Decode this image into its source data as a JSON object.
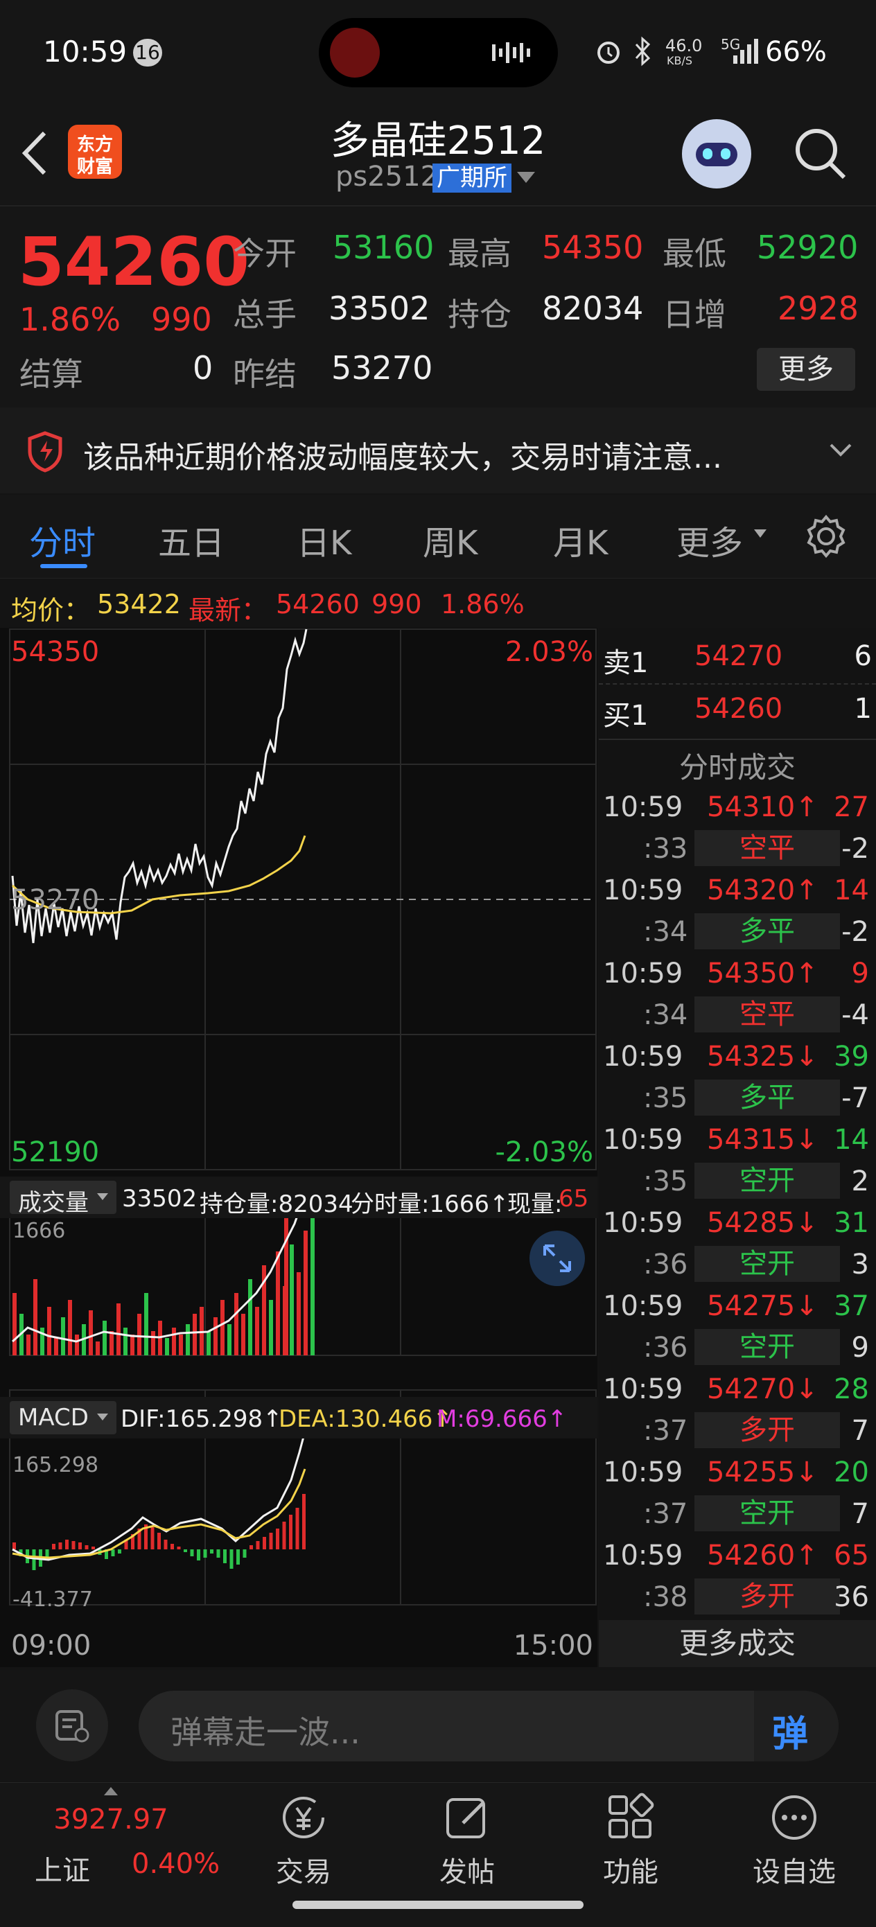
{
  "status": {
    "time": "10:59",
    "notif_count": "16",
    "net_speed": "46.0",
    "net_unit": "KB/S",
    "net_type": "5G",
    "battery": "66%"
  },
  "header": {
    "title": "多晶硅2512",
    "code": "ps2512",
    "exchange": "广期所",
    "app_logo_line1": "东方",
    "app_logo_line2": "财富"
  },
  "quote": {
    "last": "54260",
    "change_pct": "1.86%",
    "change": "990",
    "open_label": "今开",
    "open": "53160",
    "high_label": "最高",
    "high": "54350",
    "low_label": "最低",
    "low": "52920",
    "volume_label": "总手",
    "volume": "33502",
    "oi_label": "持仓",
    "oi": "82034",
    "daily_inc_label": "日增",
    "daily_inc": "2928",
    "settle_label": "结算",
    "settle": "0",
    "prev_settle_label": "昨结",
    "prev_settle": "53270",
    "more_button": "更多"
  },
  "notice": {
    "text": "该品种近期价格波动幅度较大，交易时请注意..."
  },
  "tabs": [
    {
      "label": "分时",
      "active": true
    },
    {
      "label": "五日"
    },
    {
      "label": "日K"
    },
    {
      "label": "周K"
    },
    {
      "label": "月K"
    },
    {
      "label": "更多"
    }
  ],
  "info_line": {
    "avg_label": "均价：",
    "avg": "53422",
    "latest_label": "最新：",
    "latest": "54260",
    "chg": "990",
    "pct": "1.86%"
  },
  "price_chart": {
    "y_top": "54350",
    "y_top_pct": "2.03%",
    "y_mid": "53270",
    "y_bottom": "52190",
    "y_bottom_pct": "-2.03%",
    "time_start": "09:00",
    "time_end": "15:00"
  },
  "volume_panel": {
    "selector": "成交量",
    "value": "33502",
    "oi": "持仓量:82034",
    "minute_vol": "分时量:1666↑",
    "current_label": "现量:",
    "current": "65",
    "scale": "1666"
  },
  "macd_panel": {
    "selector": "MACD",
    "dif": "DIF:165.298↑",
    "dea": "DEA:130.466↑",
    "m": "M:69.666↑",
    "scale_top": "165.298",
    "scale_bottom": "-41.377"
  },
  "order_book": [
    {
      "label": "卖1",
      "price": "54270",
      "qty": "6"
    },
    {
      "label": "买1",
      "price": "54260",
      "qty": "1"
    }
  ],
  "trades_title": "分时成交",
  "trades": [
    {
      "time": "10:59",
      "sec": ":33",
      "price": "54310↑",
      "dir": "up",
      "vol": "27",
      "type": "空平",
      "type_color": "red",
      "oi": "-2"
    },
    {
      "time": "10:59",
      "sec": ":34",
      "price": "54320↑",
      "dir": "up",
      "vol": "14",
      "type": "多平",
      "type_color": "green",
      "oi": "-2"
    },
    {
      "time": "10:59",
      "sec": ":34",
      "price": "54350↑",
      "dir": "up",
      "vol": "9",
      "type": "空平",
      "type_color": "red",
      "oi": "-4"
    },
    {
      "time": "10:59",
      "sec": ":35",
      "price": "54325↓",
      "dir": "down",
      "vol": "39",
      "type": "多平",
      "type_color": "green",
      "oi": "-7"
    },
    {
      "time": "10:59",
      "sec": ":35",
      "price": "54315↓",
      "dir": "down",
      "vol": "14",
      "type": "空开",
      "type_color": "green",
      "oi": "2"
    },
    {
      "time": "10:59",
      "sec": ":36",
      "price": "54285↓",
      "dir": "down",
      "vol": "31",
      "type": "空开",
      "type_color": "green",
      "oi": "3"
    },
    {
      "time": "10:59",
      "sec": ":36",
      "price": "54275↓",
      "dir": "down",
      "vol": "37",
      "type": "空开",
      "type_color": "green",
      "oi": "9"
    },
    {
      "time": "10:59",
      "sec": ":37",
      "price": "54270↓",
      "dir": "down",
      "vol": "28",
      "type": "多开",
      "type_color": "red",
      "oi": "7"
    },
    {
      "time": "10:59",
      "sec": ":37",
      "price": "54255↓",
      "dir": "down",
      "vol": "20",
      "type": "空开",
      "type_color": "green",
      "oi": "7"
    },
    {
      "time": "10:59",
      "sec": ":38",
      "price": "54260↑",
      "dir": "up",
      "vol": "65",
      "type": "多开",
      "type_color": "red",
      "oi": "36"
    }
  ],
  "more_trades": "更多成交",
  "danmu": {
    "placeholder": "弹幕走一波...",
    "send": "弹"
  },
  "bottom_nav": {
    "index_value": "3927.97",
    "index_name": "上证",
    "index_pct": "0.40%",
    "items": [
      "交易",
      "发帖",
      "功能",
      "设自选"
    ]
  }
}
